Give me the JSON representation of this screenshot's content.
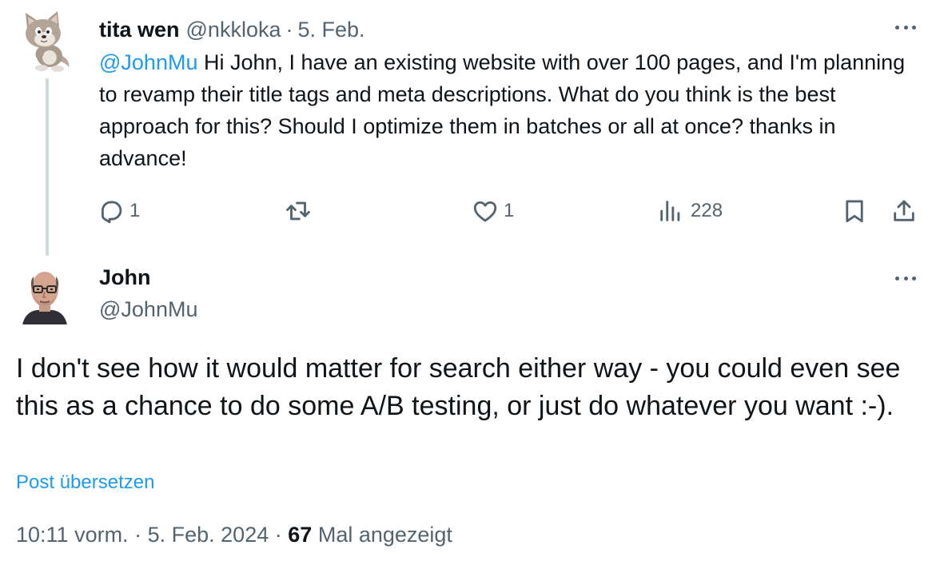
{
  "original_tweet": {
    "author_name": "tita wen",
    "author_handle": "@nkkloka",
    "separator": "·",
    "date": "5. Feb.",
    "mention": "@JohnMu",
    "text": " Hi John, I have an existing website with over 100 pages, and I'm planning to revamp their title tags and meta descriptions. What do you think is the best approach for this? Should I optimize them in batches or all at once? thanks in advance!",
    "avatar_icon": "cartoon-cat-avatar",
    "actions": {
      "reply_count": "1",
      "retweet_count": "",
      "like_count": "1",
      "views_count": "228"
    }
  },
  "reply_tweet": {
    "author_name": "John",
    "author_handle": "@JohnMu",
    "avatar_icon": "pixel-portrait-avatar",
    "text": "I don't see how it would matter for search either way - you could even see this as a chance to do some A/B testing, or just do whatever you want :-).",
    "translate_label": "Post übersetzen",
    "time": "10:11 vorm.",
    "separator": "·",
    "date": "5. Feb. 2024",
    "views_count": "67",
    "views_label": "Mal angezeigt"
  },
  "colors": {
    "text_primary": "#0f1419",
    "text_secondary": "#536471",
    "link": "#1d9bf0",
    "thread_line": "#cfd9de"
  }
}
